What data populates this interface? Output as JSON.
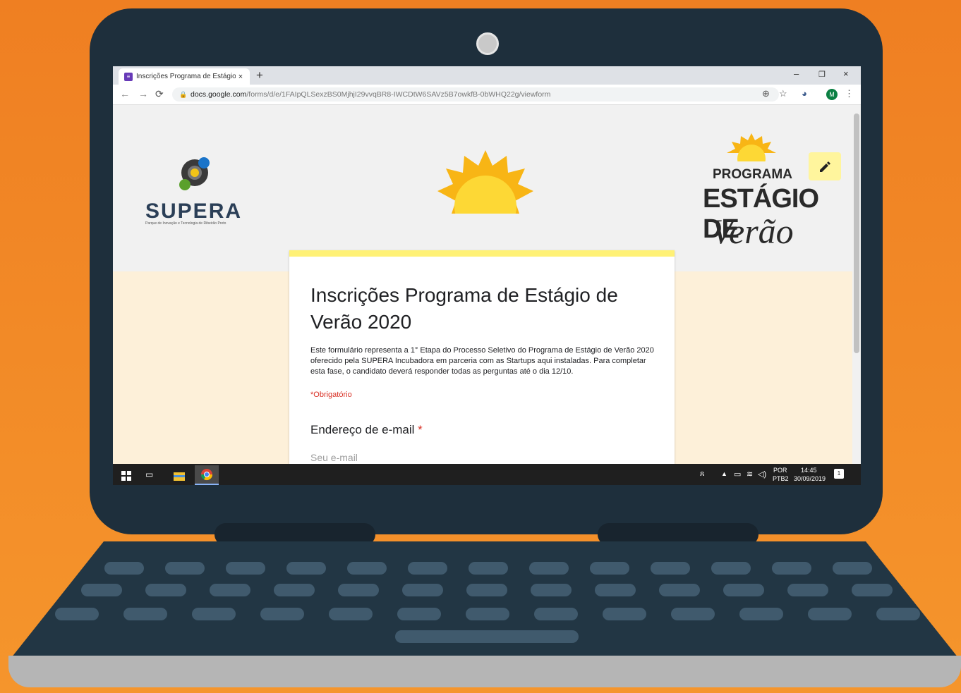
{
  "browser": {
    "tab_title": "Inscrições Programa de Estágio de",
    "tab_close": "×",
    "new_tab": "+",
    "url_domain": "docs.google.com",
    "url_path": "/forms/d/e/1FAIpQLSexzBS0MjhjI29vvqBR8-IWCDtW6SAVz5B7owkfB-0bWHQ22g/viewform",
    "avatar_letter": "M",
    "window_minimize": "–",
    "window_restore": "❐",
    "window_close": "×"
  },
  "header": {
    "supera_name": "SUPERA",
    "supera_tagline": "Parque de Inovação e Tecnologia de Ribeirão Preto",
    "program_label": "PROGRAMA",
    "program_title": "ESTÁGIO DE",
    "program_script": "Verão"
  },
  "form": {
    "title": "Inscrições Programa de Estágio de Verão 2020",
    "description": "Este formulário representa a 1° Etapa do Processo Seletivo do Programa de Estágio de Verão 2020 oferecido pela SUPERA Incubadora em parceria com as Startups aqui instaladas. Para completar esta fase, o candidato deverá responder todas as perguntas até o dia 12/10.",
    "required_note": "*Obrigatório",
    "email_label": "Endereço de e-mail",
    "required_star": "*",
    "email_placeholder": "Seu e-mail"
  },
  "taskbar": {
    "lang_top": "POR",
    "lang_bottom": "PTB2",
    "time": "14:45",
    "date": "30/09/2019",
    "notification_count": "1"
  },
  "colors": {
    "background_orange": "#ef7f22",
    "laptop_body": "#1e2f3c",
    "form_accent": "#fff176",
    "required_red": "#d93025"
  }
}
